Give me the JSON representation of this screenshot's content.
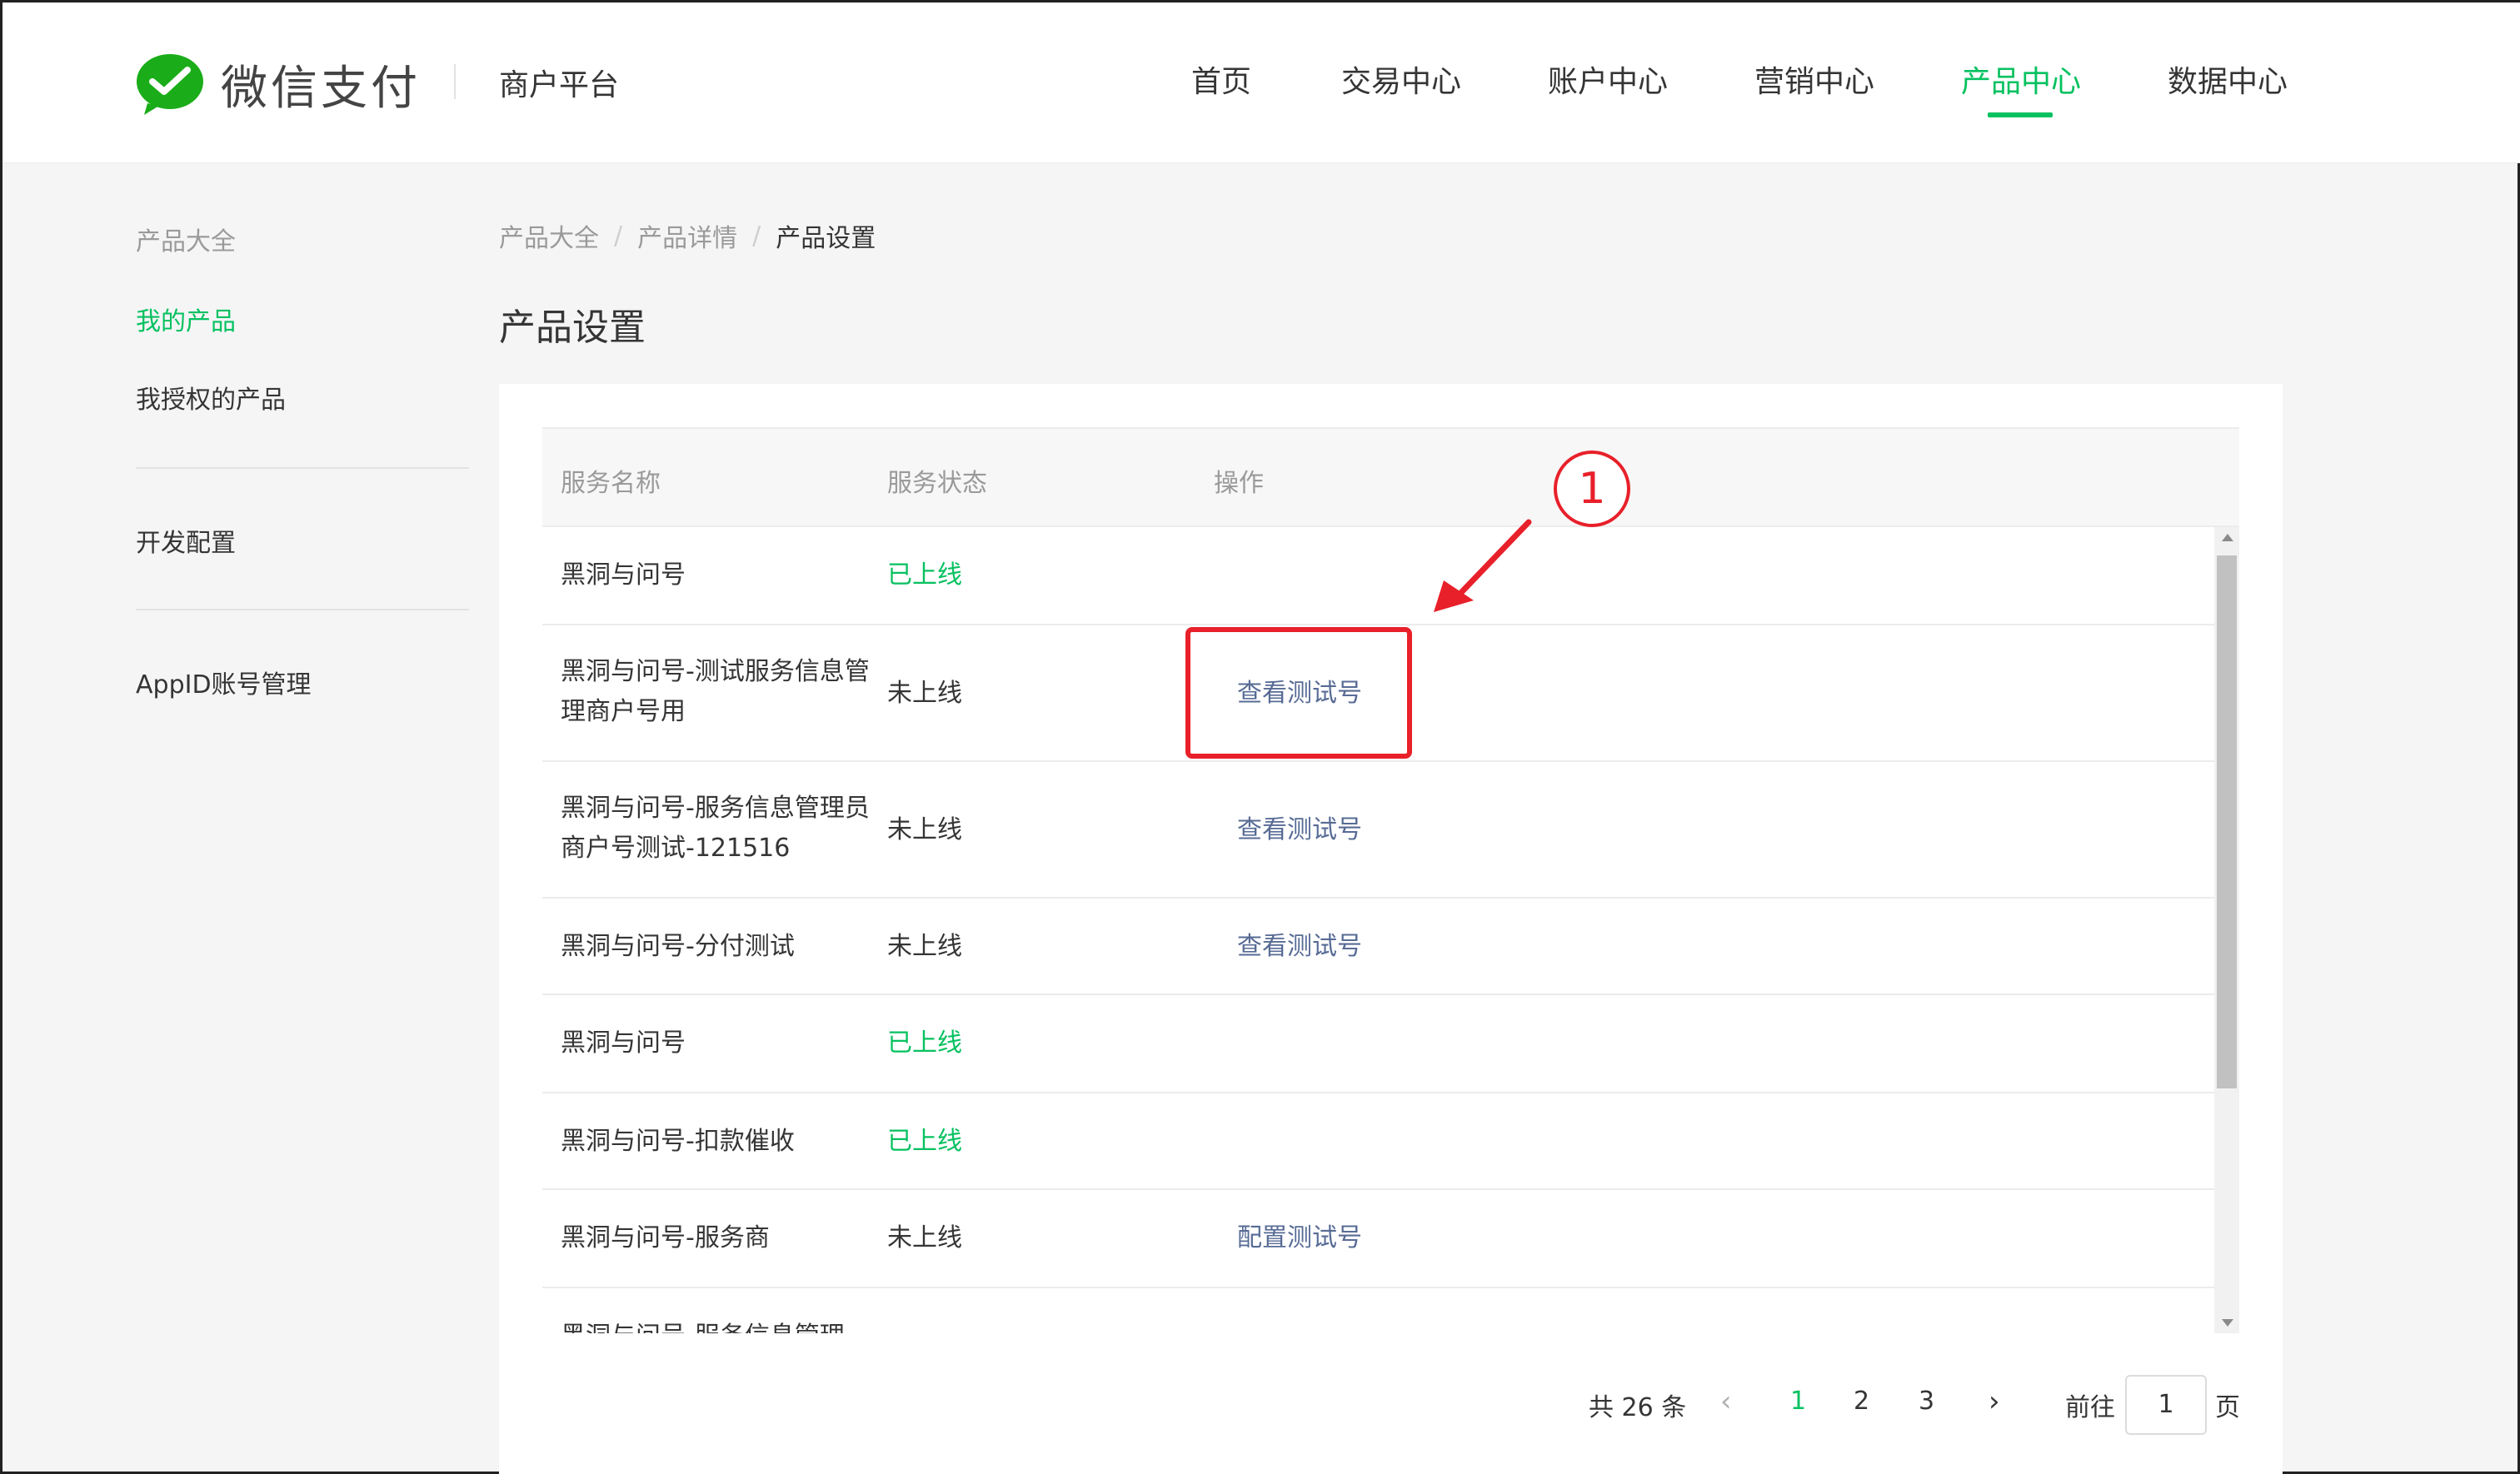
{
  "header": {
    "brand": "微信支付",
    "platform": "商户平台",
    "nav": [
      "首页",
      "交易中心",
      "账户中心",
      "营销中心",
      "产品中心",
      "数据中心"
    ],
    "active_nav": "产品中心"
  },
  "sidebar": {
    "section_title": "产品大全",
    "items": [
      "我的产品",
      "我授权的产品",
      "开发配置",
      "AppID账号管理"
    ],
    "active_item": "我的产品"
  },
  "breadcrumb": [
    "产品大全",
    "产品详情",
    "产品设置"
  ],
  "page_title": "产品设置",
  "table": {
    "columns": [
      "服务名称",
      "服务状态",
      "操作"
    ],
    "rows": [
      {
        "name": "黑洞与问号",
        "status": "已上线",
        "action": ""
      },
      {
        "name": "黑洞与问号-测试服务信息管理商户号用",
        "status": "未上线",
        "action": "查看测试号"
      },
      {
        "name": "黑洞与问号-服务信息管理员商户号测试-121516",
        "status": "未上线",
        "action": "查看测试号"
      },
      {
        "name": "黑洞与问号-分付测试",
        "status": "未上线",
        "action": "查看测试号"
      },
      {
        "name": "黑洞与问号",
        "status": "已上线",
        "action": ""
      },
      {
        "name": "黑洞与问号-扣款催收",
        "status": "已上线",
        "action": ""
      },
      {
        "name": "黑洞与问号-服务商",
        "status": "未上线",
        "action": "配置测试号"
      },
      {
        "name": "黑洞与问号-服务信息管理",
        "status": "",
        "action": ""
      }
    ]
  },
  "pagination": {
    "total": "共 26 条",
    "pages": [
      "1",
      "2",
      "3"
    ],
    "current_page": "1",
    "goto_label": "前往",
    "goto_value": "1",
    "page_suffix": "页"
  },
  "annotation": {
    "marker": "1"
  },
  "colors": {
    "brand_green": "#07c160",
    "link_blue": "#576b95",
    "annotation_red": "#e8202a"
  }
}
